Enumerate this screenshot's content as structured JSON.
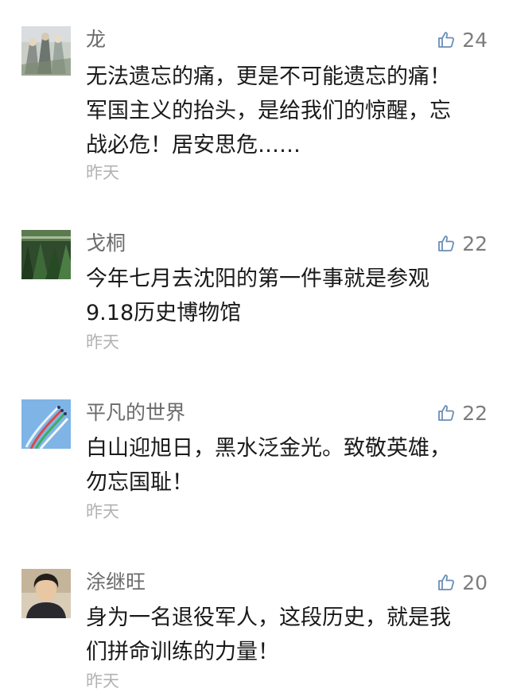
{
  "comments": [
    {
      "name": "龙",
      "likes": "24",
      "lines": [
        "无法遗忘的痛，更是不可能遗忘的痛！",
        "军国主义的抬头，是给我们的惊醒，忘",
        "战必危！居安思危……"
      ],
      "time": "昨天",
      "avatar_icon": "anime-characters-avatar"
    },
    {
      "name": "戈桐",
      "likes": "22",
      "lines": [
        "今年七月去沈阳的第一件事就是参观",
        "9.18历史博物馆"
      ],
      "time": "昨天",
      "avatar_icon": "green-forest-avatar"
    },
    {
      "name": "平凡的世界",
      "likes": "22",
      "lines": [
        "白山迎旭日，黑水泛金光。致敬英雄，",
        "勿忘国耻！"
      ],
      "time": "昨天",
      "avatar_icon": "aerobatic-jets-avatar"
    },
    {
      "name": "涂继旺",
      "likes": "20",
      "lines": [
        "身为一名退役军人，这段历史，就是我",
        "们拼命训练的力量！"
      ],
      "time": "昨天",
      "avatar_icon": "person-portrait-avatar"
    }
  ],
  "colors": {
    "name": "#6b6b6b",
    "text": "#1a1a1a",
    "time": "#b2b2b2",
    "like_icon": "#6a8fb7"
  }
}
